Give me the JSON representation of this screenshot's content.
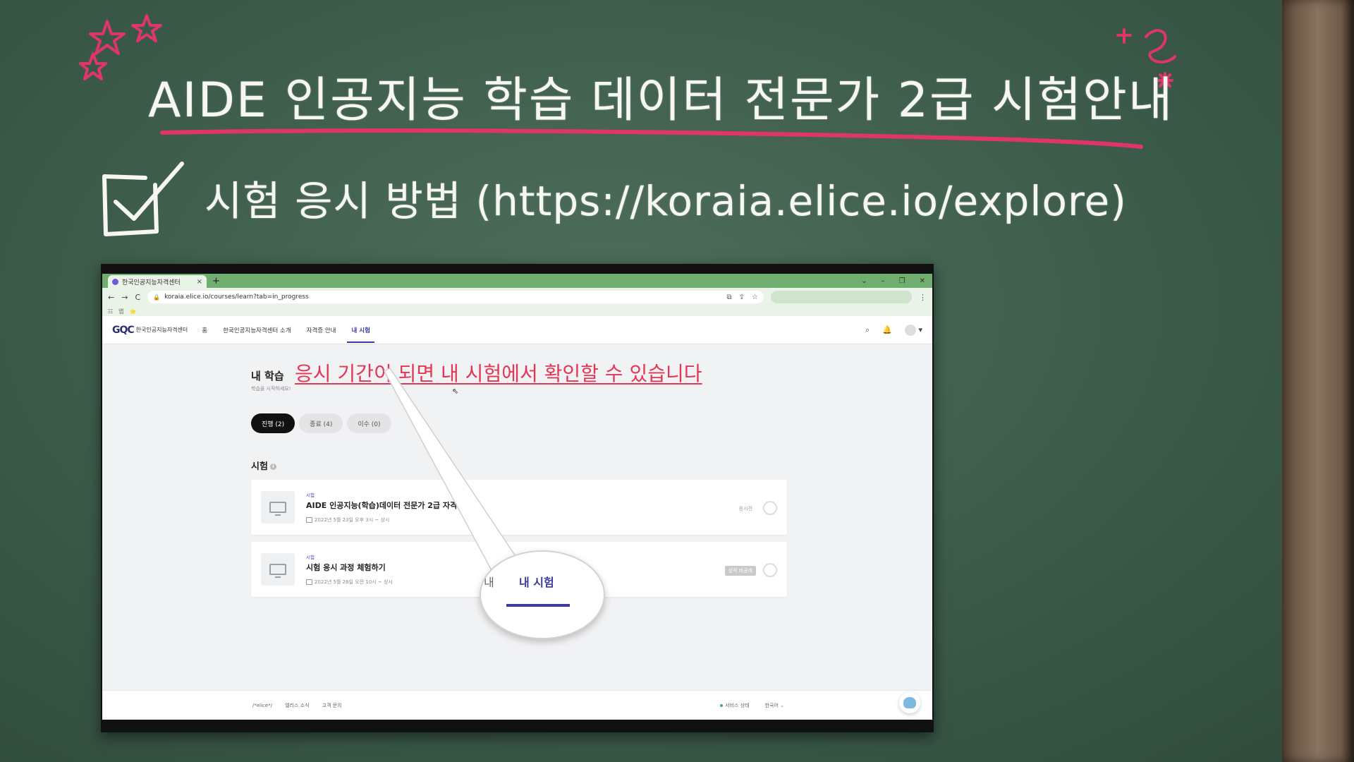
{
  "slide": {
    "title": "AIDE 인공지능 학습 데이터 전문가 2급 시험안내",
    "subtitle": "시험 응시 방법 (https://koraia.elice.io/explore)",
    "accent_color": "#e0356a",
    "chalk_color": "#f6f6f2"
  },
  "browser": {
    "tab_title": "한국인공지능자격센터",
    "tab_close": "×",
    "new_tab": "+",
    "window_controls": [
      "⌄",
      "–",
      "❐",
      "✕"
    ],
    "url": "koraia.elice.io/courses/learn?tab=in_progress",
    "nav_back": "←",
    "nav_forward": "→",
    "nav_reload": "C",
    "bookmarks": [
      "☷",
      "앱",
      "⭐"
    ]
  },
  "site": {
    "logo_mark": "GQC",
    "logo_text": "한국인공지능자격센터",
    "nav": [
      "홈",
      "한국인공지능자격센터 소개",
      "자격증 안내",
      "내 시험"
    ],
    "active_nav": "내 시험"
  },
  "page": {
    "title": "내 학습",
    "subtitle": "학습을 시작하세요!",
    "annotation": "응시 기간이 되면 내 시험에서 확인할 수 있습니다",
    "filters": [
      "진행 (2)",
      "종료 (4)",
      "이수 (0)"
    ],
    "section_title": "시험",
    "section_info": "i",
    "cards": [
      {
        "category": "시험",
        "name": "AIDE 인공지능(학습)데이터 전문가 2급 자격증 3차",
        "date": "2022년 5월 23일 오후 3시 ~ 상시",
        "status": "응시전"
      },
      {
        "category": "시험",
        "name": "시험 응시 과정 체험하기",
        "date": "2022년 5월 26일 오전 10시 ~ 상시",
        "status": "성적 비공개"
      }
    ],
    "magnifier_cut": "내",
    "magnifier_label": "내 시험"
  },
  "footer": {
    "brand": "/*elice*/",
    "links": [
      "엘리스 소식",
      "고객 문의"
    ],
    "service_status": "서비스 상태",
    "language": "한국어 ⌄"
  }
}
